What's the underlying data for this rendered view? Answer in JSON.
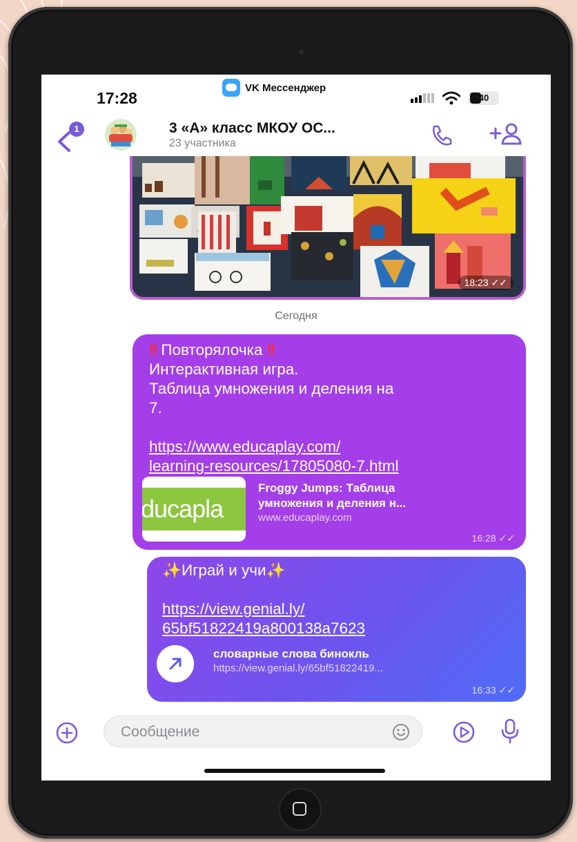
{
  "status_bar": {
    "time": "17:28",
    "app_name": "VK Мессенджер",
    "battery": "40"
  },
  "header": {
    "unread_badge": "1",
    "title": "3 «А» класс МКОУ ОС...",
    "subtitle": "23 участника"
  },
  "messages": {
    "photo_time": "18:23",
    "date_separator": "Сегодня",
    "msg1": {
      "title": "Повторялочка",
      "line1": "Интерактивная игра.",
      "line2": "Таблица умножения и деления на",
      "line3": "7.",
      "link_line1": "https://www.educaplay.com/",
      "link_line2": "learning-resources/17805080-7.html",
      "preview_logo_text": "ducapla",
      "preview_title_line1": "Froggy Jumps: Таблица",
      "preview_title_line2": "умножения и деления н...",
      "preview_url": "www.educaplay.com",
      "time": "16:28"
    },
    "msg2": {
      "title": "Играй и учи",
      "link_line1": "https://view.genial.ly/",
      "link_line2": "65bf51822419a800138a7623",
      "preview_title": "словарные слова бинокль",
      "preview_url": "https://view.genial.ly/65bf51822419...",
      "time": "16:33"
    }
  },
  "composer": {
    "placeholder": "Сообщение"
  },
  "colors": {
    "accent": "#7a5bd8",
    "bubble_purple": "#a43ee8",
    "bubble_blue": "#4f6cf6",
    "photo_border": "#b85ccf"
  },
  "icons": {
    "back": "back-arrow-icon",
    "call": "phone-icon",
    "add_member": "add-user-icon",
    "attach": "plus-circle-icon",
    "emoji": "smiley-icon",
    "video": "play-circle-icon",
    "mic": "microphone-icon",
    "link": "arrow-up-right-icon",
    "read": "double-check-icon"
  }
}
